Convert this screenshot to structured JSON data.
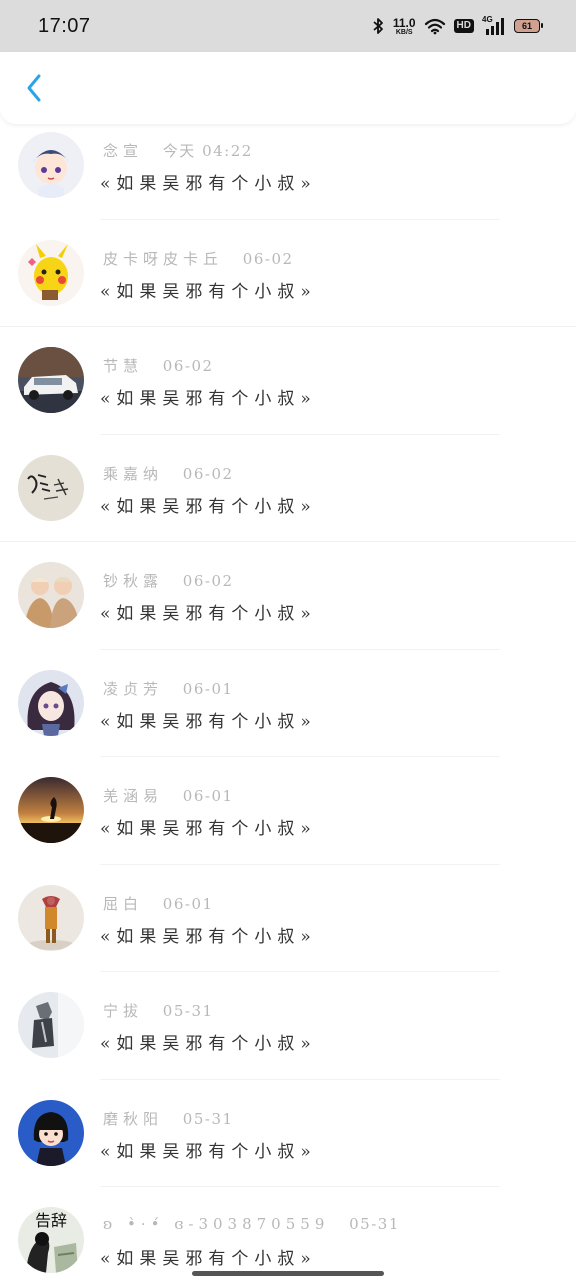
{
  "status_bar": {
    "time": "17:07",
    "net_speed_value": "11.0",
    "net_speed_unit": "KB/S",
    "hd_label": "HD",
    "signal_label": "4G",
    "battery_level": "61"
  },
  "nav": {
    "back_icon": "chevron-left-icon",
    "accent_color": "#2aa4e8"
  },
  "comments": [
    {
      "name": "念宣",
      "date": "今天 04:22",
      "text": "«如果吴邪有个小叔»"
    },
    {
      "name": "皮卡呀皮卡丘",
      "date": "06-02",
      "text": "«如果吴邪有个小叔»"
    },
    {
      "name": "节慧",
      "date": "06-02",
      "text": "«如果吴邪有个小叔»"
    },
    {
      "name": "乘嘉纳",
      "date": "06-02",
      "text": "«如果吴邪有个小叔»"
    },
    {
      "name": "钞秋露",
      "date": "06-02",
      "text": "«如果吴邪有个小叔»"
    },
    {
      "name": "凌贞芳",
      "date": "06-01",
      "text": "«如果吴邪有个小叔»"
    },
    {
      "name": "羌涵易",
      "date": "06-01",
      "text": "«如果吴邪有个小叔»"
    },
    {
      "name": "屈白",
      "date": "06-01",
      "text": "«如果吴邪有个小叔»"
    },
    {
      "name": "宁拔",
      "date": "05-31",
      "text": "«如果吴邪有个小叔»"
    },
    {
      "name": "磨秋阳",
      "date": "05-31",
      "text": "«如果吴邪有个小叔»"
    },
    {
      "name": "ʚ •̀·•́ ɞ-303870559",
      "date": "05-31",
      "text": "«如果吴邪有个小叔»"
    }
  ],
  "avatar_text_last": "告辞"
}
